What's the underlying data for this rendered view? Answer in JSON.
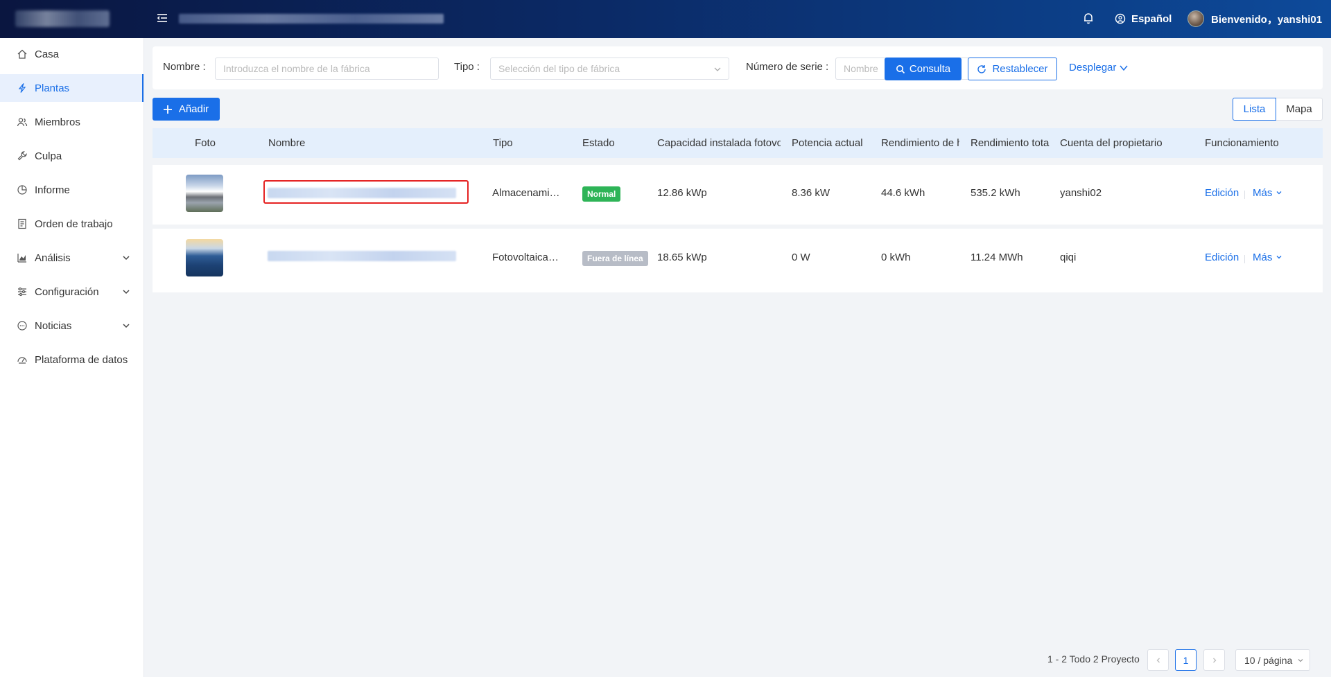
{
  "header": {
    "language": "Español",
    "welcome": "Bienvenido，yanshi01"
  },
  "sidebar": {
    "items": [
      {
        "label": "Casa",
        "icon": "home-icon"
      },
      {
        "label": "Plantas",
        "icon": "bolt-icon",
        "active": true
      },
      {
        "label": "Miembros",
        "icon": "users-icon"
      },
      {
        "label": "Culpa",
        "icon": "wrench-icon"
      },
      {
        "label": "Informe",
        "icon": "pie-chart-icon"
      },
      {
        "label": "Orden de trabajo",
        "icon": "document-icon"
      },
      {
        "label": "Análisis",
        "icon": "bar-chart-icon",
        "expandable": true
      },
      {
        "label": "Configuración",
        "icon": "sliders-icon",
        "expandable": true
      },
      {
        "label": "Noticias",
        "icon": "chat-icon",
        "expandable": true
      },
      {
        "label": "Plataforma de datos",
        "icon": "gauge-icon"
      }
    ]
  },
  "filter": {
    "name_label": "Nombre :",
    "name_placeholder": "Introduzca el nombre de la fábrica",
    "type_label": "Tipo :",
    "type_placeholder": "Selección del tipo de fábrica",
    "serial_label": "Número de serie :",
    "serial_placeholder": "Nombre",
    "search_button": "Consulta",
    "reset_button": "Restablecer",
    "expand_link": "Desplegar"
  },
  "toolbar": {
    "add_button": "Añadir",
    "view_list": "Lista",
    "view_map": "Mapa"
  },
  "table": {
    "columns": [
      "Foto",
      "Nombre",
      "Tipo",
      "Estado",
      "Capacidad instalada fotovo",
      "Potencia actual",
      "Rendimiento de h",
      "Rendimiento tota",
      "Cuenta del propietario",
      "Funcionamiento"
    ],
    "rows": [
      {
        "type": "Almacenami…",
        "status": "Normal",
        "status_color": "#2eb457",
        "capacity": "12.86 kWp",
        "power": "8.36 kW",
        "daily": "44.6 kWh",
        "total": "535.2 kWh",
        "owner": "yanshi02",
        "edit": "Edición",
        "more": "Más"
      },
      {
        "type": "Fotovoltaica…",
        "status": "Fuera de línea",
        "status_color": "#b7bcc6",
        "capacity": "18.65 kWp",
        "power": "0 W",
        "daily": "0 kWh",
        "total": "11.24 MWh",
        "owner": "qiqi",
        "edit": "Edición",
        "more": "Más"
      }
    ]
  },
  "pagination": {
    "summary": "1 - 2 Todo 2 Proyecto",
    "current_page": "1",
    "page_size": "10 / página"
  },
  "colors": {
    "primary": "#1a6fe8",
    "highlight_box": "#e52222"
  }
}
